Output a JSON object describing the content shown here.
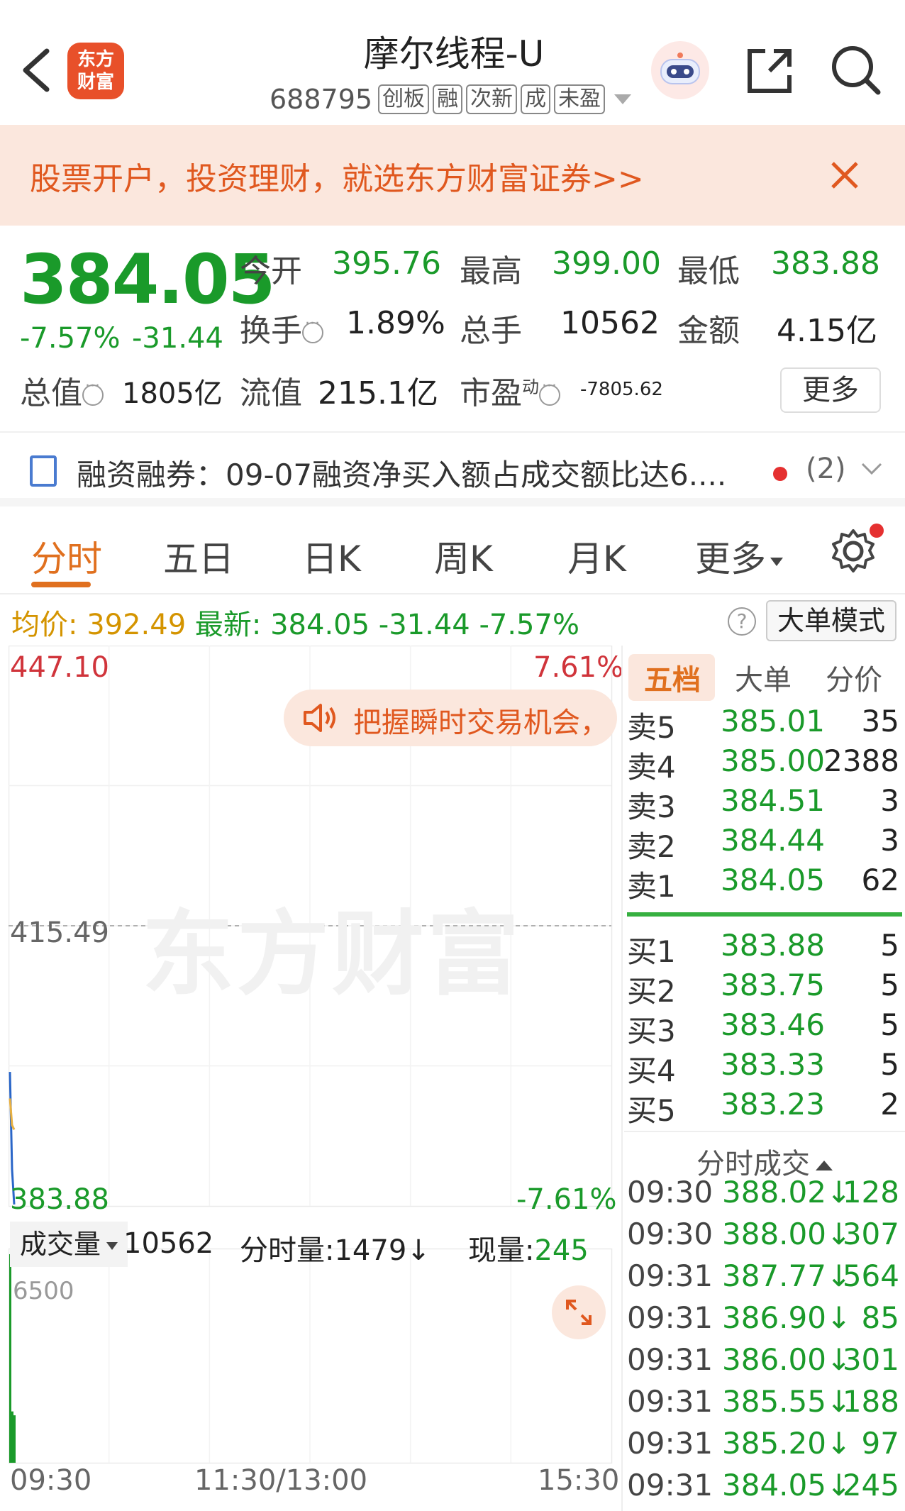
{
  "header": {
    "logo_text_line1": "东方",
    "logo_text_line2": "财富",
    "title": "摩尔线程-U",
    "code": "688795",
    "tags": [
      "创板",
      "融",
      "次新",
      "成",
      "未盈"
    ]
  },
  "banner": {
    "text": "股票开户，投资理财，就选东方财富证券>>"
  },
  "quote": {
    "price": "384.05",
    "change_pct": "-7.57%",
    "change_amt": "-31.44",
    "open_label": "今开",
    "open": "395.76",
    "high_label": "最高",
    "high": "399.00",
    "low_label": "最低",
    "low": "383.88",
    "turnover_label": "换手",
    "turnover": "1.89%",
    "volume_label": "总手",
    "volume": "10562",
    "amount_label": "金额",
    "amount": "4.15亿",
    "mktcap_label": "总值",
    "mktcap": "1805亿",
    "float_label": "流值",
    "float": "215.1亿",
    "pe_label": "市盈",
    "pe_sup": "动",
    "pe": "-7805.62",
    "more_label": "更多"
  },
  "news": {
    "text": "融资融券：09-07融资净买入额占成交额比达6....",
    "count": "(2)"
  },
  "tabs": [
    "分时",
    "五日",
    "日K",
    "周K",
    "月K",
    "更多"
  ],
  "avg_bar": {
    "avg_label": "均价:",
    "avg_value": "392.49",
    "latest_label": "最新:",
    "latest_value": "384.05",
    "latest_change": "-31.44",
    "latest_pct": "-7.57%",
    "help": "?",
    "bigorder_btn": "大单模式"
  },
  "chart": {
    "y_top": "447.10",
    "y_mid": "415.49",
    "y_bottom": "383.88",
    "pct_top": "7.61%",
    "pct_bottom": "-7.61%",
    "tooltip": "把握瞬时交易机会，",
    "watermark": "东方财富",
    "vol_scale": "6500",
    "time_labels": [
      "09:30",
      "11:30/13:00",
      "15:30"
    ]
  },
  "chart_data": {
    "type": "line",
    "title": "",
    "xlabel": "",
    "ylabel": "",
    "ylim": [
      383.88,
      447.1
    ],
    "prev_close": 415.49,
    "series": [
      {
        "values": [
          399.0,
          388.0,
          384.05
        ]
      },
      {
        "values": [
          396.0,
          393.0,
          392.49
        ]
      }
    ],
    "volume": {
      "ylim": [
        0,
        6500
      ],
      "values": [
        6500,
        1600,
        1479
      ]
    }
  },
  "volume_bar": {
    "type_label": "成交量",
    "total": "10562",
    "split_label": "分时量:",
    "split_value": "1479",
    "split_arrow": "↓",
    "now_label": "现量:",
    "now_value": "245"
  },
  "orderbook": {
    "tabs": [
      "五档",
      "大单",
      "分价"
    ],
    "asks": [
      {
        "label": "卖5",
        "price": "385.01",
        "vol": "35"
      },
      {
        "label": "卖4",
        "price": "385.00",
        "vol": "2388"
      },
      {
        "label": "卖3",
        "price": "384.51",
        "vol": "3"
      },
      {
        "label": "卖2",
        "price": "384.44",
        "vol": "3"
      },
      {
        "label": "卖1",
        "price": "384.05",
        "vol": "62"
      }
    ],
    "bids": [
      {
        "label": "买1",
        "price": "383.88",
        "vol": "5"
      },
      {
        "label": "买2",
        "price": "383.75",
        "vol": "5"
      },
      {
        "label": "买3",
        "price": "383.46",
        "vol": "5"
      },
      {
        "label": "买4",
        "price": "383.33",
        "vol": "5"
      },
      {
        "label": "买5",
        "price": "383.23",
        "vol": "2"
      }
    ],
    "ticks_title": "分时成交",
    "ticks": [
      {
        "time": "09:30",
        "price": "388.02↓",
        "vol": "128"
      },
      {
        "time": "09:30",
        "price": "388.00↓",
        "vol": "307"
      },
      {
        "time": "09:31",
        "price": "387.77↓",
        "vol": "564"
      },
      {
        "time": "09:31",
        "price": "386.90↓",
        "vol": "85"
      },
      {
        "time": "09:31",
        "price": "386.00↓",
        "vol": "301"
      },
      {
        "time": "09:31",
        "price": "385.55↓",
        "vol": "188"
      },
      {
        "time": "09:31",
        "price": "385.20↓",
        "vol": "97"
      },
      {
        "time": "09:31",
        "price": "384.05↓",
        "vol": "245"
      }
    ]
  },
  "colors": {
    "down": "#1a9a2a",
    "up": "#d0343b",
    "accent": "#e0701f",
    "avg": "#d49400",
    "banner_bg": "#fbe7dd"
  }
}
